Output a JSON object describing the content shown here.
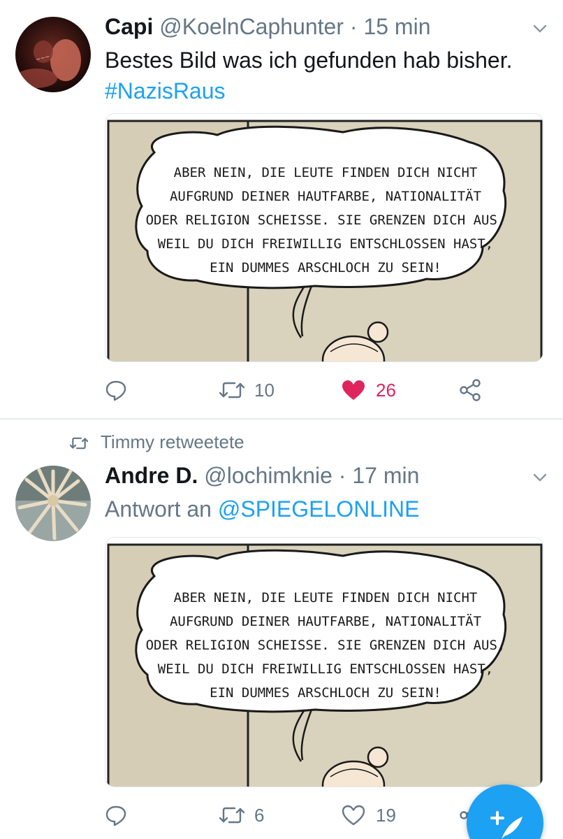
{
  "tweet1": {
    "name": "Capi",
    "handle": "@KoelnCaphunter",
    "separator": "·",
    "time": "15 min",
    "text": "Bestes Bild was ich gefunden hab bisher.",
    "hashtag": "#NazisRaus",
    "comic_text": [
      "ABER NEIN, DIE LEUTE FINDEN DICH NICHT",
      "AUFGRUND DEINER HAUTFARBE, NATIONALITÄT",
      "ODER RELIGION SCHEISSE. SIE GRENZEN DICH AUS,",
      "WEIL DU DICH FREIWILLIG ENTSCHLOSSEN HAST,",
      "EIN DUMMES ARSCHLOCH ZU SEIN!"
    ],
    "retweets": "10",
    "likes": "26",
    "liked": true,
    "like_color": "#e0245e"
  },
  "tweet2": {
    "retweet_context": "Timmy retweetete",
    "name": "Andre D.",
    "handle": "@lochimknie",
    "separator": "·",
    "time": "17 min",
    "reply_prefix": "Antwort an",
    "reply_to": "@SPIEGELONLINE",
    "comic_text": [
      "ABER NEIN, DIE LEUTE FINDEN DICH NICHT",
      "AUFGRUND DEINER HAUTFARBE, NATIONALITÄT",
      "ODER RELIGION SCHEISSE. SIE GRENZEN DICH AUS,",
      "WEIL DU DICH FREIWILLIG ENTSCHLOSSEN HAST,",
      "EIN DUMMES ARSCHLOCH ZU SEIN!"
    ],
    "retweets": "6",
    "likes": "19",
    "liked": false
  },
  "colors": {
    "accent": "#1da1f2",
    "secondary_text": "#657786",
    "comic_wall": "#d5cdb5"
  },
  "icons": [
    "reply-icon",
    "retweet-icon",
    "heart-icon",
    "share-icon",
    "chevron-down-icon",
    "compose-tweet-icon"
  ]
}
